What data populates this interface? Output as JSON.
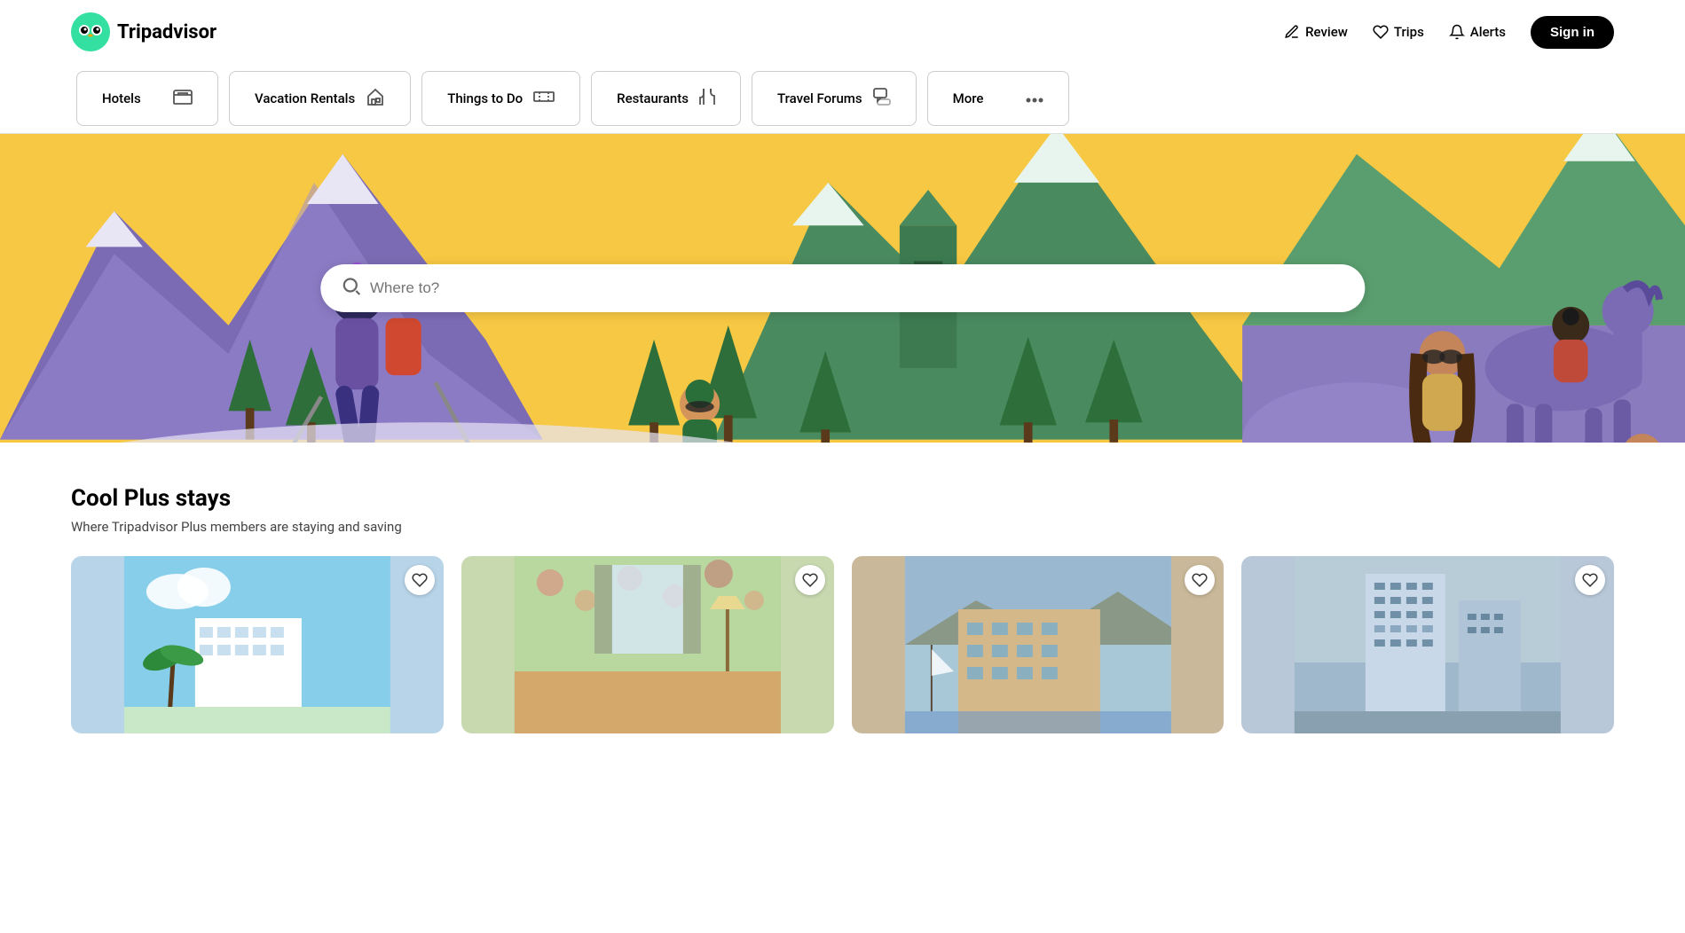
{
  "brand": {
    "name": "Tripadvisor",
    "logo_alt": "Tripadvisor logo"
  },
  "header": {
    "review_label": "Review",
    "trips_label": "Trips",
    "alerts_label": "Alerts",
    "signin_label": "Sign in"
  },
  "nav": {
    "tabs": [
      {
        "id": "hotels",
        "label": "Hotels",
        "icon": "bed-icon"
      },
      {
        "id": "vacation-rentals",
        "label": "Vacation Rentals",
        "icon": "home-icon"
      },
      {
        "id": "things-to-do",
        "label": "Things to Do",
        "icon": "ticket-icon"
      },
      {
        "id": "restaurants",
        "label": "Restaurants",
        "icon": "utensils-icon"
      },
      {
        "id": "travel-forums",
        "label": "Travel Forums",
        "icon": "forum-icon"
      },
      {
        "id": "more",
        "label": "More",
        "icon": "more-icon"
      }
    ]
  },
  "search": {
    "placeholder": "Where to?"
  },
  "cool_plus": {
    "title": "Cool Plus stays",
    "subtitle": "Where Tripadvisor Plus members are staying and saving"
  },
  "hotel_cards": [
    {
      "id": 1,
      "bg": "#b8d4e8",
      "alt": "Hotel 1 - modern white building with palms"
    },
    {
      "id": 2,
      "bg": "#c8d9b0",
      "alt": "Hotel 2 - floral wallpaper room interior"
    },
    {
      "id": 3,
      "bg": "#c9b99a",
      "alt": "Hotel 3 - beige coastal building"
    },
    {
      "id": 4,
      "bg": "#b8c8d8",
      "alt": "Hotel 4 - tall modern hotel building"
    }
  ],
  "colors": {
    "hero_sky": "#f7c843",
    "hero_mountain_left": "#7b6bb5",
    "hero_mountain_mid": "#5a9e6f",
    "hero_snow": "#e8e8f5",
    "tripadvisor_green": "#34e0a1",
    "accent": "#000"
  }
}
